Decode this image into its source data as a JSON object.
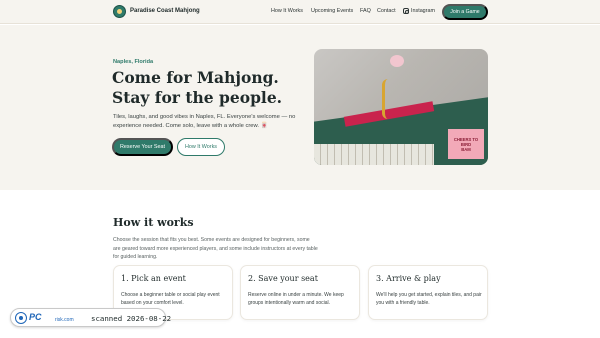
{
  "header": {
    "brand": "Paradise Coast Mahjong",
    "logo_icon": "mahjong-logo-icon",
    "nav": {
      "how": "How It Works",
      "events": "Upcoming Events",
      "faq": "FAQ",
      "contact": "Contact",
      "instagram": "Instagram"
    },
    "join_button": "Join a Game"
  },
  "hero": {
    "eyebrow": "Naples, Florida",
    "title": "Come for Mahjong. Stay for the people.",
    "subtitle": "Tiles, laughs, and good vibes in Naples, FL. Everyone's welcome — no experience needed. Come solo, leave with a whole crew. 🀄",
    "cta_primary": "Reserve Your Seat",
    "cta_secondary": "How It Works",
    "photo_sign_lines": [
      "CHEERS TO",
      "BIRD",
      "BAM"
    ]
  },
  "how_it_works": {
    "title": "How it works",
    "description": "Choose the session that fits you best. Some events are designed for beginners, some are geared toward more experienced players, and some include instructors at every table for guided learning.",
    "steps": [
      {
        "title": "1. Pick an event",
        "text": "Choose a beginner table or social play event based on your comfort level."
      },
      {
        "title": "2. Save your seat",
        "text": "Reserve online in under a minute. We keep groups intentionally warm and social."
      },
      {
        "title": "3. Arrive & play",
        "text": "We'll help you get started, explain tiles, and pair you with a friendly table."
      }
    ]
  },
  "watermark": {
    "brand": "PC",
    "brand_small": "risk.com",
    "text": "scanned 2026-08-22"
  },
  "colors": {
    "accent": "#2f7a6a",
    "hero_bg": "#f6f4ef"
  }
}
